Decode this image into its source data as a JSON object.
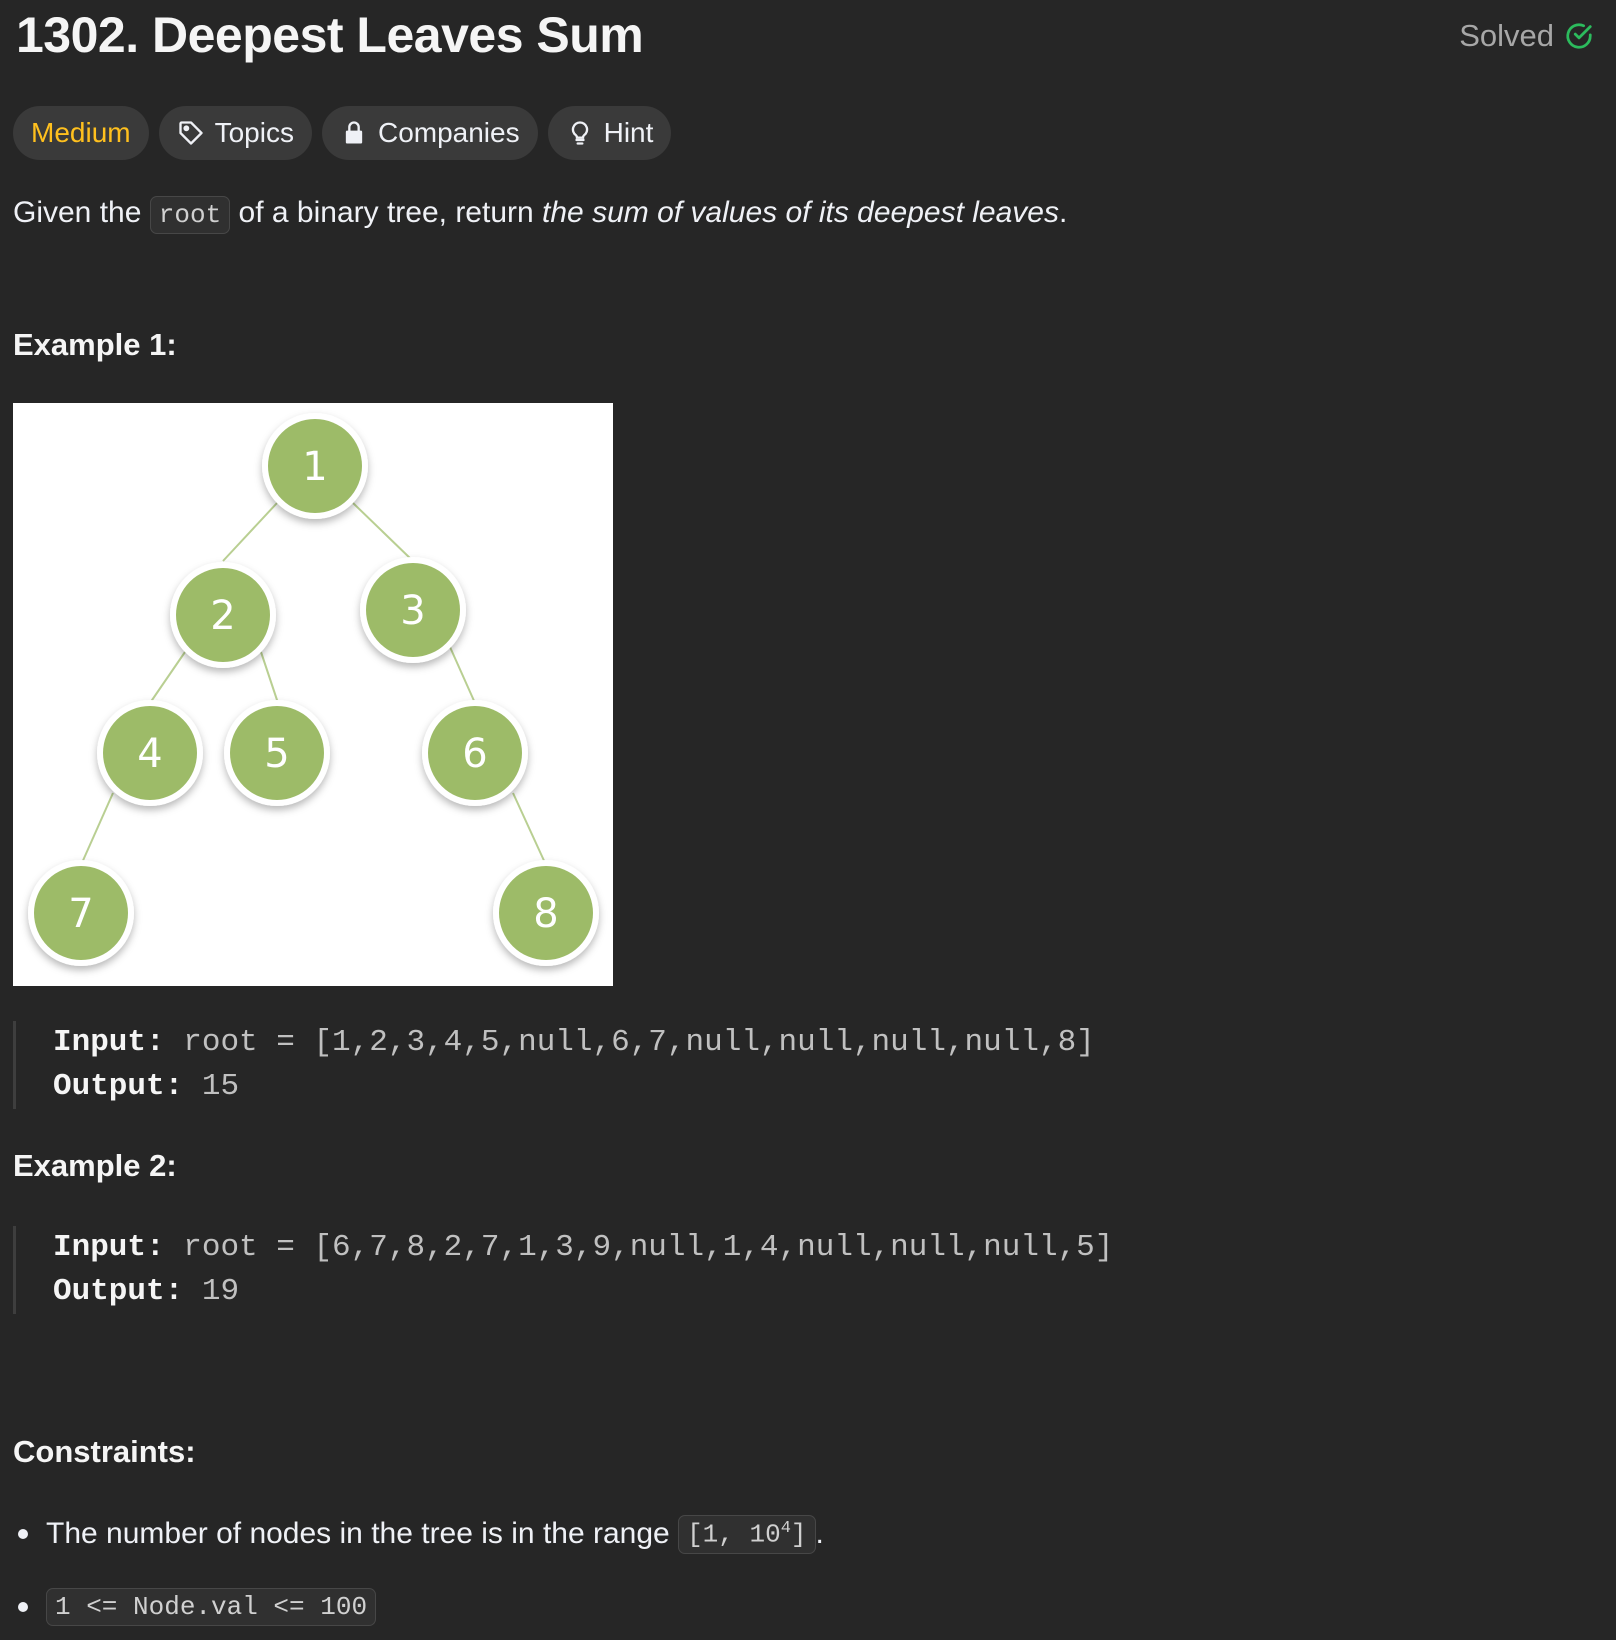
{
  "problem": {
    "title": "1302. Deepest Leaves Sum",
    "status": "Solved"
  },
  "tags": {
    "difficulty": "Medium",
    "topics": "Topics",
    "companies": "Companies",
    "hint": "Hint"
  },
  "description": {
    "pre": "Given the",
    "code": "root",
    "mid": "of a binary tree, return",
    "emphasis": "the sum of values of its deepest leaves",
    "post": "."
  },
  "example1": {
    "heading": "Example 1:",
    "tree_nodes": [
      "1",
      "2",
      "3",
      "4",
      "5",
      "6",
      "7",
      "8"
    ],
    "input_label": "Input:",
    "input_value": "root = [1,2,3,4,5,null,6,7,null,null,null,null,8]",
    "output_label": "Output:",
    "output_value": "15"
  },
  "example2": {
    "heading": "Example 2:",
    "input_label": "Input:",
    "input_value": "root = [6,7,8,2,7,1,3,9,null,1,4,null,null,null,5]",
    "output_label": "Output:",
    "output_value": "19"
  },
  "constraints": {
    "heading": "Constraints:",
    "c1_text": "The number of nodes in the tree is in the range",
    "c1_code_pre": "[1, 10",
    "c1_code_sup": "4",
    "c1_code_post": "]",
    "c1_end": ".",
    "c2_code": "1 <= Node.val <= 100"
  },
  "colors": {
    "background": "#262626",
    "difficulty_medium": "#ffc01e",
    "solved_check": "#2cbb5d",
    "tree_node_fill": "#9dbb68"
  }
}
